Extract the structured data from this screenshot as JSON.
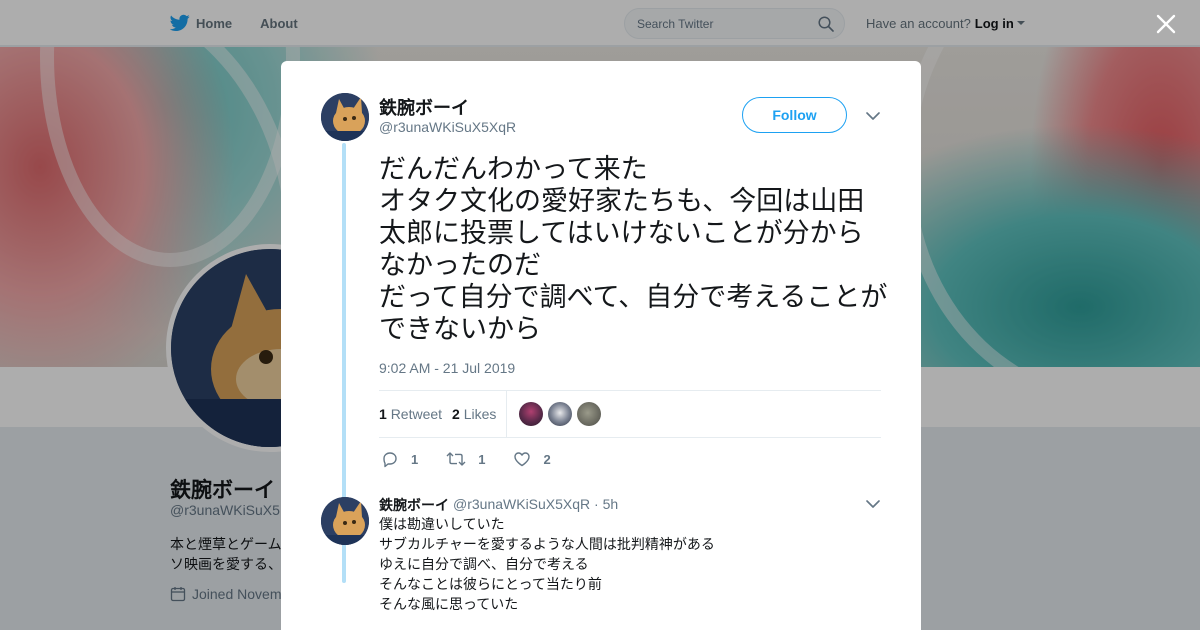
{
  "nav": {
    "home_label": "Home",
    "about_label": "About",
    "search_placeholder": "Search Twitter",
    "account_prompt": "Have an account?",
    "login_label": "Log in"
  },
  "profile": {
    "name": "鉄腕ボーイ",
    "handle": "@r3unaWKiSuX5",
    "bio_line1": "本と煙草とゲーム",
    "bio_line2": "ソ映画を愛する、",
    "joined": "Joined Novem"
  },
  "tweet": {
    "author_name": "鉄腕ボーイ",
    "author_handle": "@r3unaWKiSuX5XqR",
    "follow_label": "Follow",
    "text": "だんだんわかって来た\nオタク文化の愛好家たちも、今回は山田太郎に投票してはいけないことが分からなかったのだ\nだって自分で調べて、自分で考えることができないから",
    "timestamp": "9:02 AM - 21 Jul 2019",
    "retweet_count": "1",
    "retweet_label": "Retweet",
    "like_count": "2",
    "like_label": "Likes",
    "reply_action_count": "1",
    "retweet_action_count": "1",
    "like_action_count": "2"
  },
  "reply": {
    "author_name": "鉄腕ボーイ",
    "meta": "@r3unaWKiSuX5XqR · 5h",
    "text": "僕は勘違いしていた\nサブカルチャーを愛するような人間は批判精神がある\nゆえに自分で調べ、自分で考える\nそんなことは彼らにとって当たり前\nそんな風に思っていた"
  },
  "colors": {
    "brand": "#1da1f2",
    "thread_line": "#b3dff7",
    "muted": "#657786"
  },
  "icons": [
    "twitter-bird-icon",
    "search-icon",
    "close-icon",
    "chevron-down-icon",
    "reply-icon",
    "retweet-icon",
    "heart-icon",
    "calendar-icon"
  ]
}
